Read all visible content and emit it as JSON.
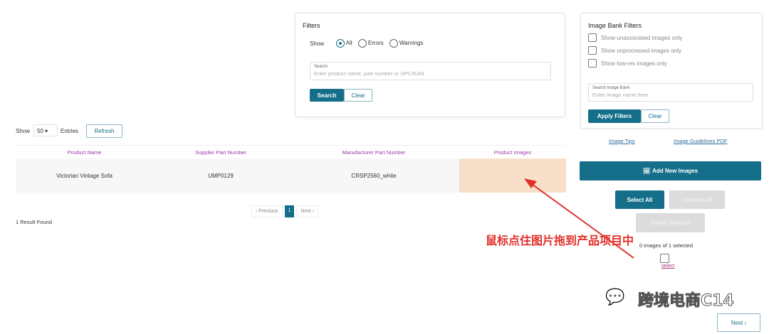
{
  "filters": {
    "title": "Filters",
    "show_label": "Show",
    "options": [
      "All",
      "Errors",
      "Warnings"
    ],
    "selected": "All",
    "search_label": "Search",
    "search_placeholder": "Enter product name, part number or UPC/EAN",
    "search_btn": "Search",
    "clear_btn": "Clear"
  },
  "image_bank": {
    "title": "Image Bank Filters",
    "checks": [
      "Show unassociated images only",
      "Show unprocessed images only",
      "Show low-res images only"
    ],
    "search_label": "Search image Bank",
    "search_placeholder": "Enter image name here",
    "apply_btn": "Apply Filters",
    "clear_btn": "Clear",
    "link_tips": "Image Tips",
    "link_pdf": "Image Guidelines PDF"
  },
  "table_controls": {
    "show": "Show",
    "entries_value": "50",
    "entries": "Entries",
    "refresh": "Refresh"
  },
  "table": {
    "headers": [
      "Product Name",
      "Supplier Part Number",
      "Manufacturer Part Number",
      "Product Images"
    ],
    "rows": [
      [
        "Victorian Vintage Sofa",
        "UMP0129",
        "CRSP2560_white",
        ""
      ]
    ]
  },
  "pagination": {
    "previous": "‹ Previous",
    "page": "1",
    "next": "Next ›"
  },
  "result_count": "1 Result Found",
  "image_panel": {
    "add_btn": "Add New Images",
    "select_all": "Select All",
    "unselect_all": "Unselect All",
    "delete_selected": "Delete Selected",
    "selected_text": "0 images of 1 selected",
    "item_label": "select"
  },
  "annotation": "鼠标点住图片拖到产品项目中",
  "watermark": "跨境电商C14",
  "next_btn": "Next ›",
  "colors": {
    "primary": "#156f8a",
    "header": "#9b3aa8",
    "highlight": "#f7dfc9",
    "annotation": "#e0302a"
  }
}
